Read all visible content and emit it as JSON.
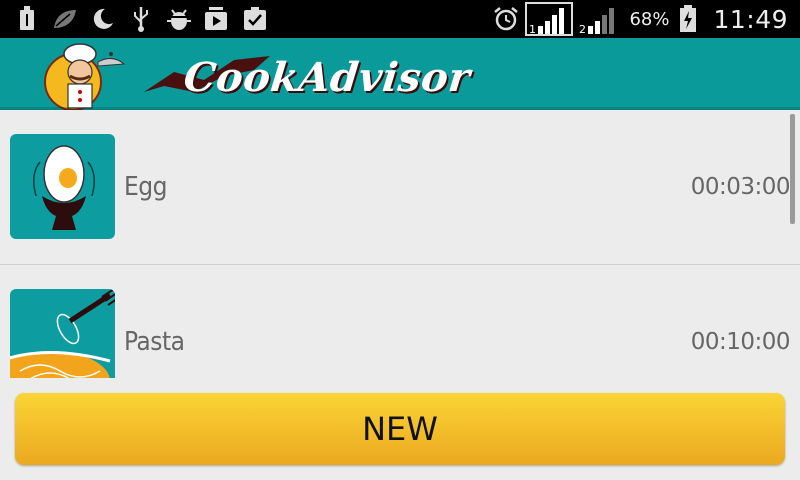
{
  "status_bar": {
    "left_icons": [
      "usb-icon",
      "leaf-icon",
      "moon-icon",
      "usb-debug-icon",
      "android-bug-icon",
      "media-play-icon",
      "clipboard-check-icon"
    ],
    "right_icons": [
      "alarm-icon",
      "sim1-signal-icon",
      "sim2-signal-icon",
      "battery-charging-icon"
    ],
    "battery_percent": "68%",
    "time": "11:49"
  },
  "app_bar": {
    "logo_text": "CookAdvisor",
    "color": "#0a9a9a"
  },
  "list": {
    "items": [
      {
        "name": "Egg",
        "time": "00:03:00",
        "icon": "egg-icon"
      },
      {
        "name": "Pasta",
        "time": "00:10:00",
        "icon": "pasta-fork-icon"
      }
    ]
  },
  "new_button": {
    "label": "NEW",
    "color": "#f2be2a"
  }
}
